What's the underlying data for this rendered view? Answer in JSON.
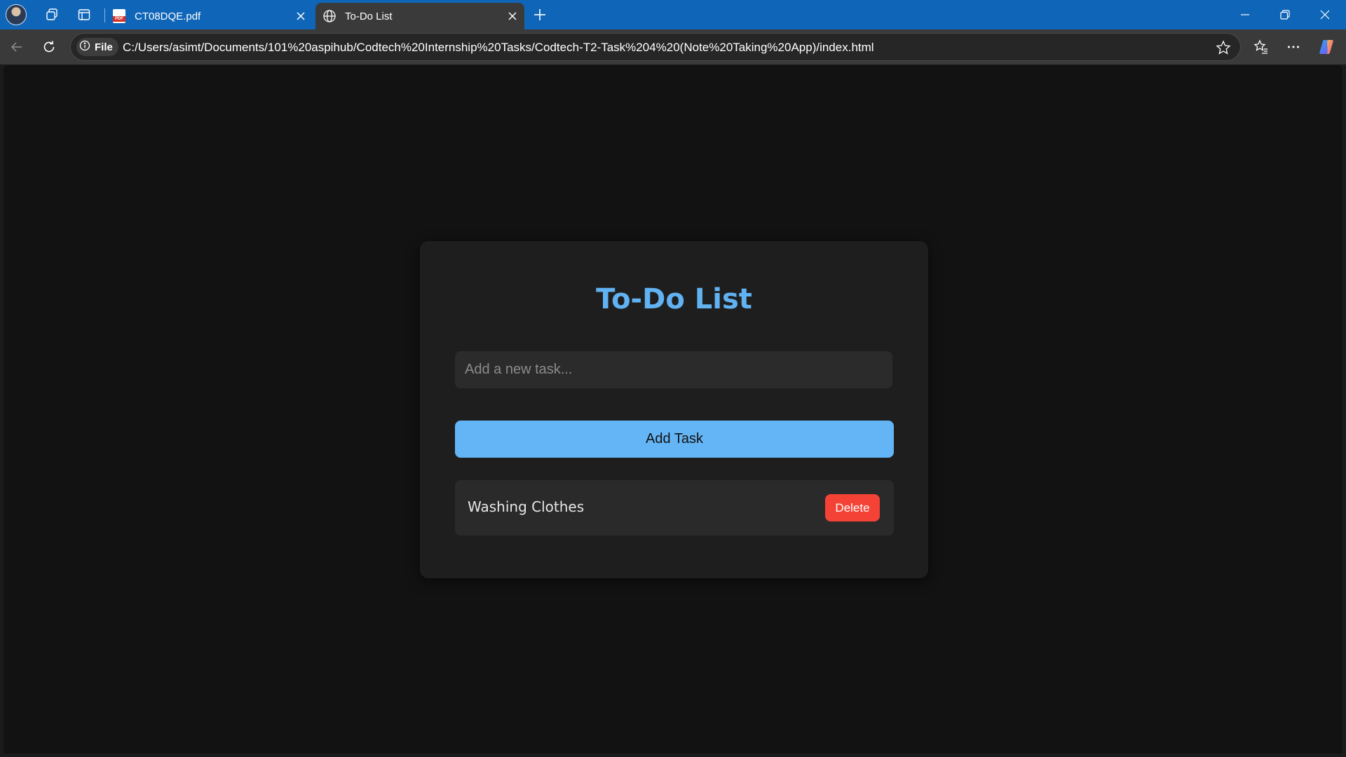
{
  "browser": {
    "tabs": [
      {
        "title": "CT08DQE.pdf",
        "favicon": "pdf-icon",
        "active": false
      },
      {
        "title": "To-Do List",
        "favicon": "globe-icon",
        "active": true
      }
    ],
    "address": {
      "scheme_chip": "File",
      "url": "C:/Users/asimt/Documents/101%20aspihub/Codtech%20Internship%20Tasks/Codtech-T2-Task%204%20(Note%20Taking%20App)/index.html"
    },
    "colors": {
      "titlebar": "#0f66b8",
      "toolbar": "#3a3a3a",
      "page_bg": "#121212"
    }
  },
  "app": {
    "title": "To-Do List",
    "input": {
      "placeholder": "Add a new task...",
      "value": ""
    },
    "add_button_label": "Add Task",
    "tasks": [
      {
        "text": "Washing Clothes",
        "delete_label": "Delete"
      }
    ],
    "colors": {
      "accent": "#64b5f6",
      "title": "#61b2f2",
      "danger": "#f44336",
      "card": "#1e1e1e"
    }
  }
}
